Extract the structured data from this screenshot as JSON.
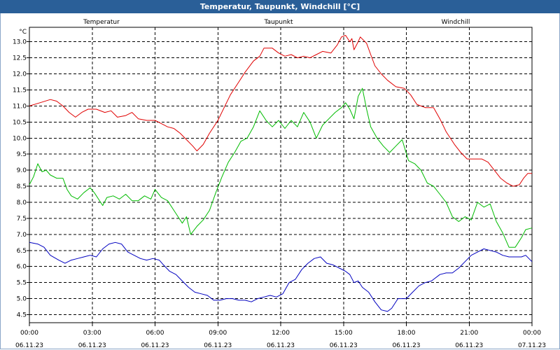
{
  "title": "Temperatur, Taupunkt, Windchill [°C]",
  "chart_data": {
    "type": "line",
    "ylabel": "°C",
    "ylim": [
      4.25,
      13.45
    ],
    "yticks": [
      "4.5",
      "5.0",
      "5.5",
      "6.0",
      "6.5",
      "7.0",
      "7.5",
      "8.0",
      "8.5",
      "9.0",
      "9.5",
      "10.0",
      "10.5",
      "11.0",
      "11.5",
      "12.0",
      "12.5",
      "13.0"
    ],
    "xlim": [
      0,
      24
    ],
    "xticks": [
      {
        "time": "00:00",
        "date": "06.11.23"
      },
      {
        "time": "03:00",
        "date": "06.11.23"
      },
      {
        "time": "06:00",
        "date": "06.11.23"
      },
      {
        "time": "09:00",
        "date": "06.11.23"
      },
      {
        "time": "12:00",
        "date": "06.11.23"
      },
      {
        "time": "15:00",
        "date": "06.11.23"
      },
      {
        "time": "18:00",
        "date": "06.11.23"
      },
      {
        "time": "21:00",
        "date": "06.11.23"
      },
      {
        "time": "00:00",
        "date": "07.11.23"
      }
    ],
    "grid": true,
    "legend_position": "top",
    "series": [
      {
        "name": "Temperatur",
        "color": "#e00000",
        "points": [
          [
            0,
            11.0
          ],
          [
            0.5,
            11.1
          ],
          [
            1,
            11.2
          ],
          [
            1.3,
            11.15
          ],
          [
            1.6,
            11.0
          ],
          [
            1.9,
            10.8
          ],
          [
            2.2,
            10.65
          ],
          [
            2.5,
            10.8
          ],
          [
            2.8,
            10.9
          ],
          [
            3.2,
            10.9
          ],
          [
            3.6,
            10.8
          ],
          [
            3.9,
            10.85
          ],
          [
            4.2,
            10.65
          ],
          [
            4.6,
            10.7
          ],
          [
            4.9,
            10.8
          ],
          [
            5.2,
            10.6
          ],
          [
            5.6,
            10.55
          ],
          [
            6.0,
            10.55
          ],
          [
            6.3,
            10.45
          ],
          [
            6.6,
            10.35
          ],
          [
            6.9,
            10.3
          ],
          [
            7.2,
            10.15
          ],
          [
            7.5,
            9.95
          ],
          [
            7.8,
            9.75
          ],
          [
            8.0,
            9.6
          ],
          [
            8.3,
            9.8
          ],
          [
            8.6,
            10.15
          ],
          [
            9.0,
            10.55
          ],
          [
            9.3,
            10.95
          ],
          [
            9.6,
            11.35
          ],
          [
            10.0,
            11.75
          ],
          [
            10.3,
            12.05
          ],
          [
            10.7,
            12.4
          ],
          [
            11.0,
            12.55
          ],
          [
            11.2,
            12.8
          ],
          [
            11.6,
            12.8
          ],
          [
            11.9,
            12.65
          ],
          [
            12.2,
            12.55
          ],
          [
            12.5,
            12.6
          ],
          [
            12.8,
            12.5
          ],
          [
            13.1,
            12.55
          ],
          [
            13.4,
            12.5
          ],
          [
            13.7,
            12.6
          ],
          [
            14.0,
            12.7
          ],
          [
            14.4,
            12.65
          ],
          [
            14.7,
            12.9
          ],
          [
            14.9,
            13.15
          ],
          [
            15.1,
            13.2
          ],
          [
            15.3,
            13.0
          ],
          [
            15.4,
            13.1
          ],
          [
            15.5,
            12.75
          ],
          [
            15.7,
            13.0
          ],
          [
            15.8,
            13.15
          ],
          [
            16.1,
            12.95
          ],
          [
            16.3,
            12.6
          ],
          [
            16.5,
            12.25
          ],
          [
            16.8,
            12.0
          ],
          [
            17.1,
            11.8
          ],
          [
            17.5,
            11.6
          ],
          [
            17.9,
            11.55
          ],
          [
            18.2,
            11.35
          ],
          [
            18.5,
            11.05
          ],
          [
            18.9,
            10.95
          ],
          [
            19.3,
            10.95
          ],
          [
            19.6,
            10.6
          ],
          [
            19.9,
            10.2
          ],
          [
            20.3,
            9.8
          ],
          [
            20.6,
            9.55
          ],
          [
            20.9,
            9.35
          ],
          [
            21.3,
            9.35
          ],
          [
            21.6,
            9.35
          ],
          [
            21.9,
            9.25
          ],
          [
            22.2,
            9.0
          ],
          [
            22.5,
            8.75
          ],
          [
            22.8,
            8.6
          ],
          [
            23.1,
            8.5
          ],
          [
            23.4,
            8.55
          ],
          [
            23.6,
            8.75
          ],
          [
            23.8,
            8.9
          ],
          [
            24.0,
            8.9
          ]
        ]
      },
      {
        "name": "Taupunkt",
        "color": "#0000c0",
        "points": [
          [
            0,
            6.75
          ],
          [
            0.4,
            6.7
          ],
          [
            0.7,
            6.6
          ],
          [
            1.0,
            6.35
          ],
          [
            1.4,
            6.2
          ],
          [
            1.7,
            6.1
          ],
          [
            2.0,
            6.2
          ],
          [
            2.3,
            6.25
          ],
          [
            2.6,
            6.3
          ],
          [
            2.9,
            6.35
          ],
          [
            3.2,
            6.3
          ],
          [
            3.5,
            6.55
          ],
          [
            3.8,
            6.7
          ],
          [
            4.1,
            6.75
          ],
          [
            4.4,
            6.7
          ],
          [
            4.7,
            6.45
          ],
          [
            5.0,
            6.35
          ],
          [
            5.3,
            6.25
          ],
          [
            5.6,
            6.2
          ],
          [
            5.9,
            6.25
          ],
          [
            6.2,
            6.2
          ],
          [
            6.4,
            6.05
          ],
          [
            6.7,
            5.85
          ],
          [
            7.0,
            5.75
          ],
          [
            7.3,
            5.55
          ],
          [
            7.6,
            5.35
          ],
          [
            7.9,
            5.2
          ],
          [
            8.2,
            5.15
          ],
          [
            8.5,
            5.1
          ],
          [
            8.8,
            4.95
          ],
          [
            9.1,
            4.95
          ],
          [
            9.4,
            5.0
          ],
          [
            9.7,
            5.0
          ],
          [
            10.0,
            4.95
          ],
          [
            10.3,
            4.95
          ],
          [
            10.6,
            4.9
          ],
          [
            10.9,
            5.0
          ],
          [
            11.2,
            5.05
          ],
          [
            11.5,
            5.1
          ],
          [
            11.8,
            5.05
          ],
          [
            12.1,
            5.15
          ],
          [
            12.4,
            5.5
          ],
          [
            12.7,
            5.6
          ],
          [
            13.0,
            5.9
          ],
          [
            13.3,
            6.1
          ],
          [
            13.6,
            6.25
          ],
          [
            13.9,
            6.3
          ],
          [
            14.2,
            6.1
          ],
          [
            14.5,
            6.05
          ],
          [
            14.8,
            5.95
          ],
          [
            15.1,
            5.85
          ],
          [
            15.3,
            5.75
          ],
          [
            15.5,
            5.5
          ],
          [
            15.7,
            5.55
          ],
          [
            15.9,
            5.35
          ],
          [
            16.2,
            5.2
          ],
          [
            16.5,
            4.9
          ],
          [
            16.8,
            4.65
          ],
          [
            17.1,
            4.6
          ],
          [
            17.3,
            4.7
          ],
          [
            17.6,
            5.0
          ],
          [
            18.0,
            5.0
          ],
          [
            18.3,
            5.2
          ],
          [
            18.6,
            5.4
          ],
          [
            18.9,
            5.5
          ],
          [
            19.2,
            5.55
          ],
          [
            19.6,
            5.75
          ],
          [
            19.9,
            5.8
          ],
          [
            20.2,
            5.8
          ],
          [
            20.5,
            5.95
          ],
          [
            20.8,
            6.15
          ],
          [
            21.1,
            6.35
          ],
          [
            21.4,
            6.45
          ],
          [
            21.7,
            6.55
          ],
          [
            22.0,
            6.5
          ],
          [
            22.3,
            6.45
          ],
          [
            22.6,
            6.35
          ],
          [
            22.9,
            6.3
          ],
          [
            23.2,
            6.3
          ],
          [
            23.5,
            6.3
          ],
          [
            23.7,
            6.35
          ],
          [
            24.0,
            6.15
          ]
        ]
      },
      {
        "name": "Windchill",
        "color": "#00bb00",
        "points": [
          [
            0,
            8.55
          ],
          [
            0.2,
            8.8
          ],
          [
            0.4,
            9.2
          ],
          [
            0.6,
            8.95
          ],
          [
            0.8,
            9.0
          ],
          [
            1.0,
            8.85
          ],
          [
            1.3,
            8.75
          ],
          [
            1.6,
            8.75
          ],
          [
            1.8,
            8.4
          ],
          [
            2.0,
            8.2
          ],
          [
            2.3,
            8.1
          ],
          [
            2.6,
            8.3
          ],
          [
            2.9,
            8.45
          ],
          [
            3.1,
            8.3
          ],
          [
            3.3,
            8.1
          ],
          [
            3.5,
            7.9
          ],
          [
            3.7,
            8.15
          ],
          [
            4.0,
            8.2
          ],
          [
            4.3,
            8.1
          ],
          [
            4.6,
            8.25
          ],
          [
            4.9,
            8.05
          ],
          [
            5.2,
            8.05
          ],
          [
            5.5,
            8.2
          ],
          [
            5.8,
            8.1
          ],
          [
            6.0,
            8.4
          ],
          [
            6.3,
            8.15
          ],
          [
            6.6,
            8.05
          ],
          [
            6.9,
            7.75
          ],
          [
            7.1,
            7.55
          ],
          [
            7.3,
            7.35
          ],
          [
            7.5,
            7.55
          ],
          [
            7.7,
            7.0
          ],
          [
            8.0,
            7.25
          ],
          [
            8.3,
            7.45
          ],
          [
            8.6,
            7.75
          ],
          [
            8.9,
            8.3
          ],
          [
            9.2,
            8.8
          ],
          [
            9.5,
            9.25
          ],
          [
            9.8,
            9.55
          ],
          [
            10.1,
            9.9
          ],
          [
            10.4,
            10.0
          ],
          [
            10.7,
            10.35
          ],
          [
            11.0,
            10.85
          ],
          [
            11.3,
            10.55
          ],
          [
            11.6,
            10.35
          ],
          [
            11.9,
            10.55
          ],
          [
            12.2,
            10.3
          ],
          [
            12.5,
            10.55
          ],
          [
            12.8,
            10.35
          ],
          [
            13.1,
            10.8
          ],
          [
            13.4,
            10.5
          ],
          [
            13.7,
            10.0
          ],
          [
            14.0,
            10.4
          ],
          [
            14.3,
            10.6
          ],
          [
            14.6,
            10.8
          ],
          [
            14.9,
            10.95
          ],
          [
            15.1,
            11.1
          ],
          [
            15.3,
            10.9
          ],
          [
            15.5,
            10.6
          ],
          [
            15.7,
            11.3
          ],
          [
            15.9,
            11.55
          ],
          [
            16.1,
            10.9
          ],
          [
            16.3,
            10.35
          ],
          [
            16.6,
            10.0
          ],
          [
            16.9,
            9.75
          ],
          [
            17.2,
            9.55
          ],
          [
            17.5,
            9.75
          ],
          [
            17.8,
            9.95
          ],
          [
            18.1,
            9.3
          ],
          [
            18.4,
            9.2
          ],
          [
            18.7,
            9.0
          ],
          [
            19.0,
            8.6
          ],
          [
            19.3,
            8.5
          ],
          [
            19.6,
            8.25
          ],
          [
            19.9,
            8.0
          ],
          [
            20.2,
            7.55
          ],
          [
            20.5,
            7.4
          ],
          [
            20.8,
            7.55
          ],
          [
            21.1,
            7.45
          ],
          [
            21.4,
            8.0
          ],
          [
            21.7,
            7.85
          ],
          [
            22.0,
            7.95
          ],
          [
            22.3,
            7.4
          ],
          [
            22.6,
            7.05
          ],
          [
            22.9,
            6.6
          ],
          [
            23.2,
            6.6
          ],
          [
            23.5,
            6.9
          ],
          [
            23.7,
            7.15
          ],
          [
            24.0,
            7.2
          ]
        ]
      }
    ]
  }
}
